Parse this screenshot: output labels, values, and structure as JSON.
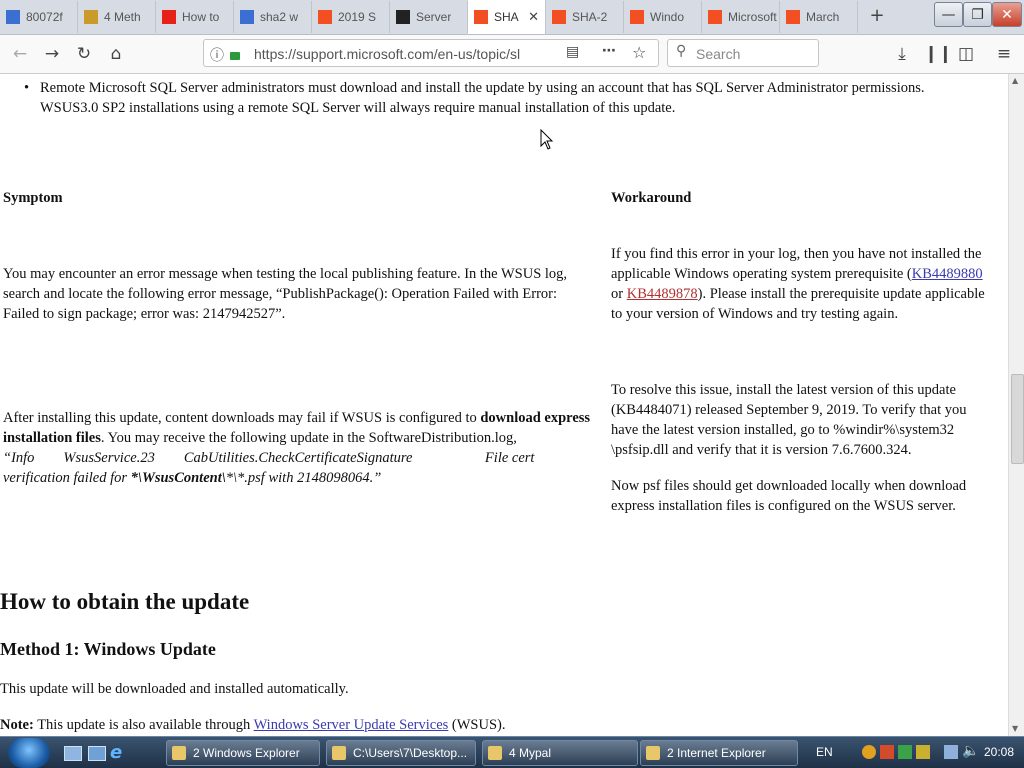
{
  "browser": {
    "tabs": [
      {
        "label": "80072f",
        "fav_color": "#3b6fd1"
      },
      {
        "label": "4 Meth",
        "fav_color": "#c99b2a"
      },
      {
        "label": "How to",
        "fav_color": "#e62117"
      },
      {
        "label": "sha2 w",
        "fav_color": "#3b6fd1"
      },
      {
        "label": "2019 S",
        "fav_color": "#f25022"
      },
      {
        "label": "Server",
        "fav_color": "#222222"
      },
      {
        "label": "SHA",
        "fav_color": "#f25022",
        "active": true
      },
      {
        "label": "SHA-2",
        "fav_color": "#f25022"
      },
      {
        "label": "Windo",
        "fav_color": "#f25022"
      },
      {
        "label": "Microsoft",
        "fav_color": "#f25022"
      },
      {
        "label": "March",
        "fav_color": "#f25022"
      }
    ],
    "tab_close_glyph": "✕",
    "new_tab_glyph": "+",
    "window_buttons": {
      "minimize": "—",
      "restore": "❐",
      "close": "✕"
    },
    "url": "https://support.microsoft.com/en-us/topic/sl",
    "search_placeholder": "Search"
  },
  "content": {
    "bullet_text": "Remote Microsoft SQL Server administrators must download and install the update by using an account that has SQL Server Administrator permissions. WSUS3.0 SP2 installations using a remote SQL Server will always require manual installation of this update.",
    "symptom_header": "Symptom",
    "workaround_header": "Workaround",
    "row1_symptom": "You may encounter an error message when testing the local publishing feature. In the WSUS log, search and locate the following error message, “PublishPackage(): Operation Failed with Error: Failed to sign package; error was: 2147942527”.",
    "row1_workaround_pre": "If you find this error in your log, then you have not installed the applicable Windows operating system prerequisite (",
    "row1_link1": "KB4489880",
    "row1_or": " or ",
    "row1_link2": "KB4489878",
    "row1_workaround_post": ").  Please install the prerequisite update applicable to your version of Windows and try testing again.",
    "row2_symptom_pre": "After installing this update, content downloads may fail if WSUS is configured to ",
    "row2_symptom_bold": "download express installation files",
    "row2_symptom_post": ". You may receive the following update in the SoftwareDistribution.log,",
    "row2_italic_1": "“Info        WsusService.23        CabUtilities.CheckCertificateSignature                    File cert verification failed for ",
    "row2_italic_bold": "*\\WsusContent\\",
    "row2_italic_2": "*\\*.psf with 2148098064.”",
    "row2_workaround_1": "To resolve this issue, install the latest version of this update (KB4484071) released September 9, 2019. To verify that you have the latest version installed, go to %windir%\\system32 \\psfsip.dll and verify that it is version 7.6.7600.324.",
    "row2_workaround_2": "Now psf files should get downloaded locally when download express installation files is configured on the WSUS server.",
    "h2": "How to obtain the update",
    "h3": "Method 1: Windows Update",
    "p1": "This update will be downloaded and installed automatically.",
    "note_label": "Note:",
    "note_text": " This update is also available through ",
    "note_link": "Windows Server Update Services",
    "note_end": " (WSUS)."
  },
  "taskbar": {
    "buttons": [
      {
        "label": "2 Windows Explorer"
      },
      {
        "label": "C:\\Users\\7\\Desktop..."
      },
      {
        "label": "4 Mypal"
      },
      {
        "label": "2 Internet Explorer"
      }
    ],
    "lang": "EN",
    "time": "20:08"
  }
}
